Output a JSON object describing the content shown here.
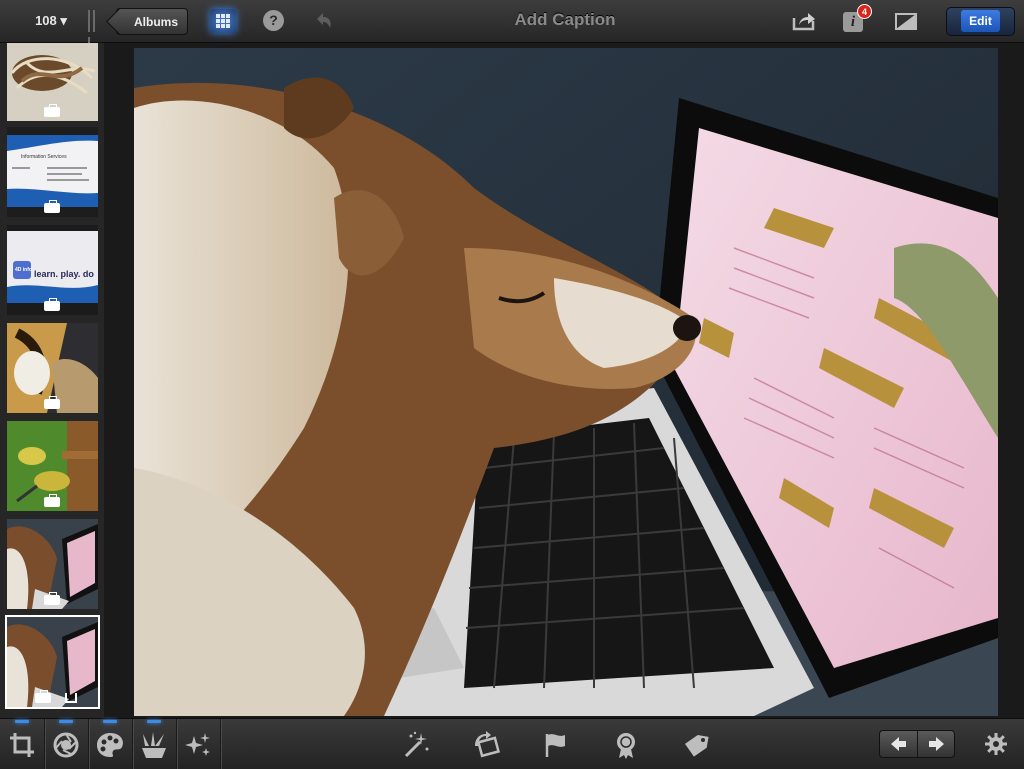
{
  "topbar": {
    "photo_count": "108 ▾",
    "albums_label": "Albums",
    "help_label": "?",
    "title": "Add Caption",
    "info_label": "i",
    "info_badge_count": "4",
    "edit_label": "Edit"
  },
  "icons": {
    "grid": "grid-icon",
    "help": "help-icon",
    "undo": "undo-icon",
    "share": "share-icon",
    "info": "info-icon",
    "compare": "compare-icon",
    "crop": "crop-icon",
    "exposure": "aperture-icon",
    "color": "palette-icon",
    "brushes": "brushes-icon",
    "effects": "sparkles-icon",
    "enhance": "magic-wand-icon",
    "rotate": "rotate-icon",
    "flag": "flag-icon",
    "favorite": "rosette-icon",
    "tag": "tag-icon",
    "previous": "arrow-left-icon",
    "next": "arrow-right-icon",
    "settings": "gear-icon"
  },
  "thumbnails": [
    {
      "subject": "rope"
    },
    {
      "subject": "business card"
    },
    {
      "subject": "business card",
      "card_logo": "4D\ninfo",
      "card_text": "learn. play. do"
    },
    {
      "subject": "collie"
    },
    {
      "subject": "bird"
    },
    {
      "subject": "collie with laptop"
    },
    {
      "subject": "collie with laptop",
      "selected": true
    }
  ],
  "card2": {
    "line1": "Information Services"
  },
  "colors": {
    "accent_blue": "#3d8be5",
    "badge_red": "#d8261c",
    "edit_blue": "#1d55b8",
    "toolbar_dark": "#2b2b2b"
  }
}
